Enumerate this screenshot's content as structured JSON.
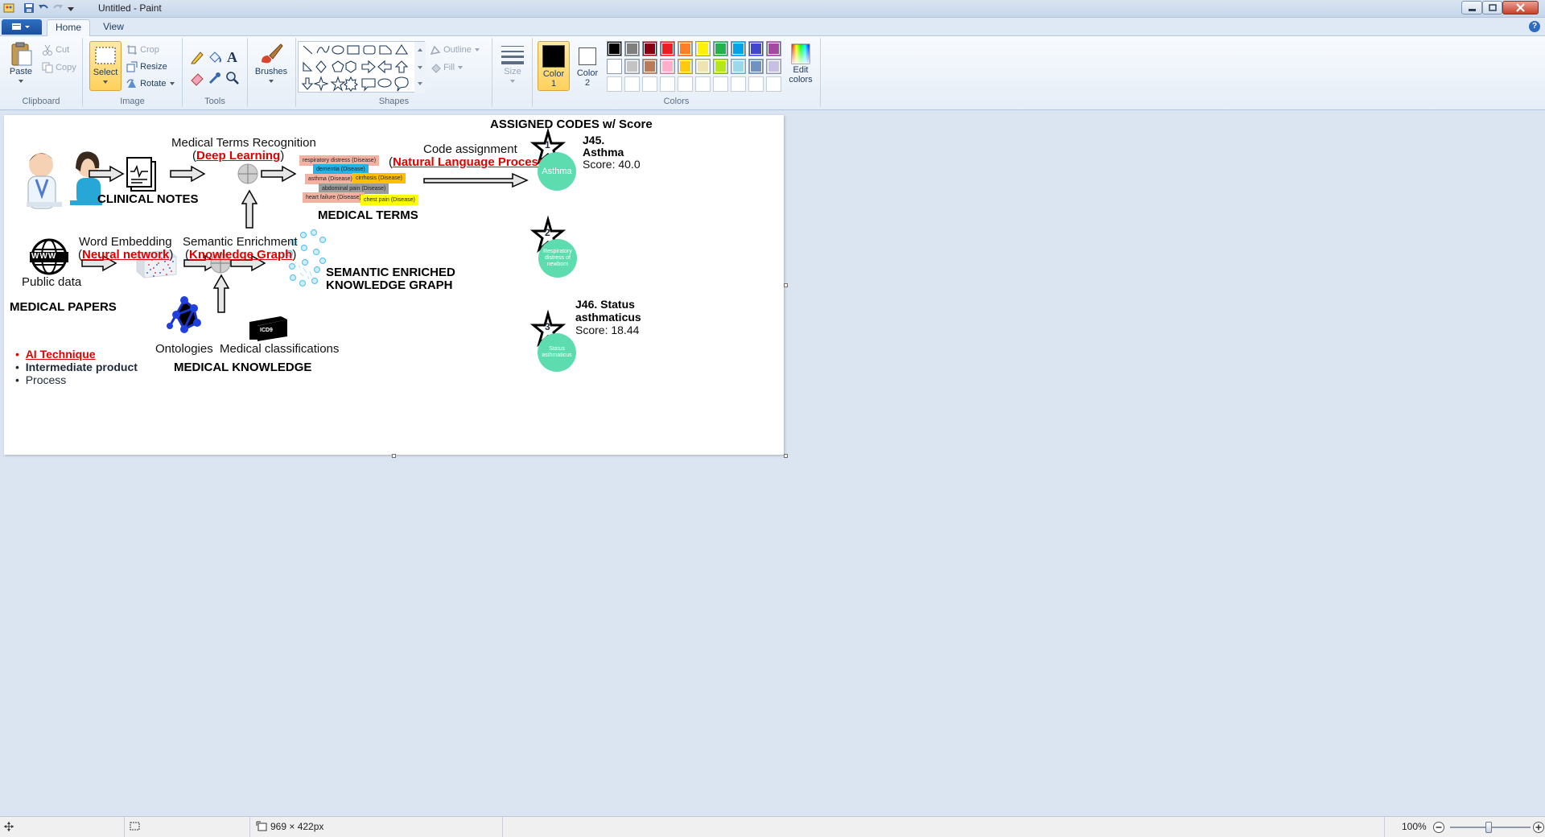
{
  "window": {
    "title": "Untitled - Paint"
  },
  "tabs": {
    "home": "Home",
    "view": "View"
  },
  "ribbon": {
    "clipboard": {
      "label": "Clipboard",
      "paste": "Paste",
      "cut": "Cut",
      "copy": "Copy"
    },
    "image": {
      "label": "Image",
      "select": "Select",
      "crop": "Crop",
      "resize": "Resize",
      "rotate": "Rotate"
    },
    "tools": {
      "label": "Tools"
    },
    "brushes": {
      "label": "Brushes"
    },
    "shapes": {
      "label": "Shapes",
      "outline": "Outline",
      "fill": "Fill"
    },
    "size": {
      "label": "Size"
    },
    "colors": {
      "label": "Colors",
      "color1": "Color 1",
      "color2": "Color 2",
      "edit": "Edit colors",
      "color1_value": "#000000",
      "color2_value": "#ffffff",
      "palette": [
        "#000000",
        "#7f7f7f",
        "#880015",
        "#ed1c24",
        "#ff7f27",
        "#fff200",
        "#22b14c",
        "#00a2e8",
        "#3f48cc",
        "#a349a4",
        "#ffffff",
        "#c3c3c3",
        "#b97a57",
        "#ffaec9",
        "#ffc90e",
        "#efe4b0",
        "#b5e61d",
        "#99d9ea",
        "#7092be",
        "#c8bfe7"
      ]
    }
  },
  "canvas": {
    "assigned_codes": "ASSIGNED CODES w/ Score",
    "med_terms_recognition": "Medical Terms Recognition",
    "deep_learning": "Deep Learning",
    "code_assignment": "Code assignment",
    "nlp": "Natural Language Processing",
    "clinical_notes": "CLINICAL NOTES",
    "medical_terms": "MEDICAL TERMS",
    "word_embedding": "Word Embedding",
    "neural_network": "Neural network",
    "semantic_enrichment": "Semantic Enrichment",
    "knowledge_graph": "Knowledge Graph",
    "public_data": "Public data",
    "www": "WWW",
    "semantic_kg_line1": "SEMANTIC ENRICHED",
    "semantic_kg_line2": "KNOWLEDGE GRAPH",
    "medical_papers": "MEDICAL PAPERS",
    "ontologies": "Ontologies",
    "medical_classifications": "Medical classifications",
    "icd9": "ICD9",
    "medical_knowledge": "MEDICAL KNOWLEDGE",
    "legend": {
      "ai": "AI Technique",
      "intermediate": "Intermediate product",
      "process": "Process"
    },
    "tags": [
      {
        "text": "respiratory distress (Disease)",
        "color": "#f3b1a1"
      },
      {
        "text": "dementia (Disease)",
        "color": "#25b2e6"
      },
      {
        "text": "asthma (Disease)",
        "color": "#f3b1a1"
      },
      {
        "text": "cirrhosis (Disease)",
        "color": "#ffbf00"
      },
      {
        "text": "abdominal pain (Disease)",
        "color": "#9b9b9b"
      },
      {
        "text": "heart failure (Disease)",
        "color": "#f3b1a1"
      },
      {
        "text": "chest pain (Disease)",
        "color": "#ffff00"
      }
    ],
    "codes": [
      {
        "rank": "1",
        "circle": "Asthma",
        "code": "J45.",
        "name": "Asthma",
        "score": "Score: 40.0"
      },
      {
        "rank": "2",
        "circle": "Respiratory distress of newborn"
      },
      {
        "rank": "3",
        "circle": "Status asthmaticus",
        "code_line1": "J46. Status",
        "code_line2": "asthmaticus",
        "score": "Score: 18.44"
      }
    ]
  },
  "status": {
    "dimensions": "969 × 422px",
    "zoom": "100%"
  }
}
